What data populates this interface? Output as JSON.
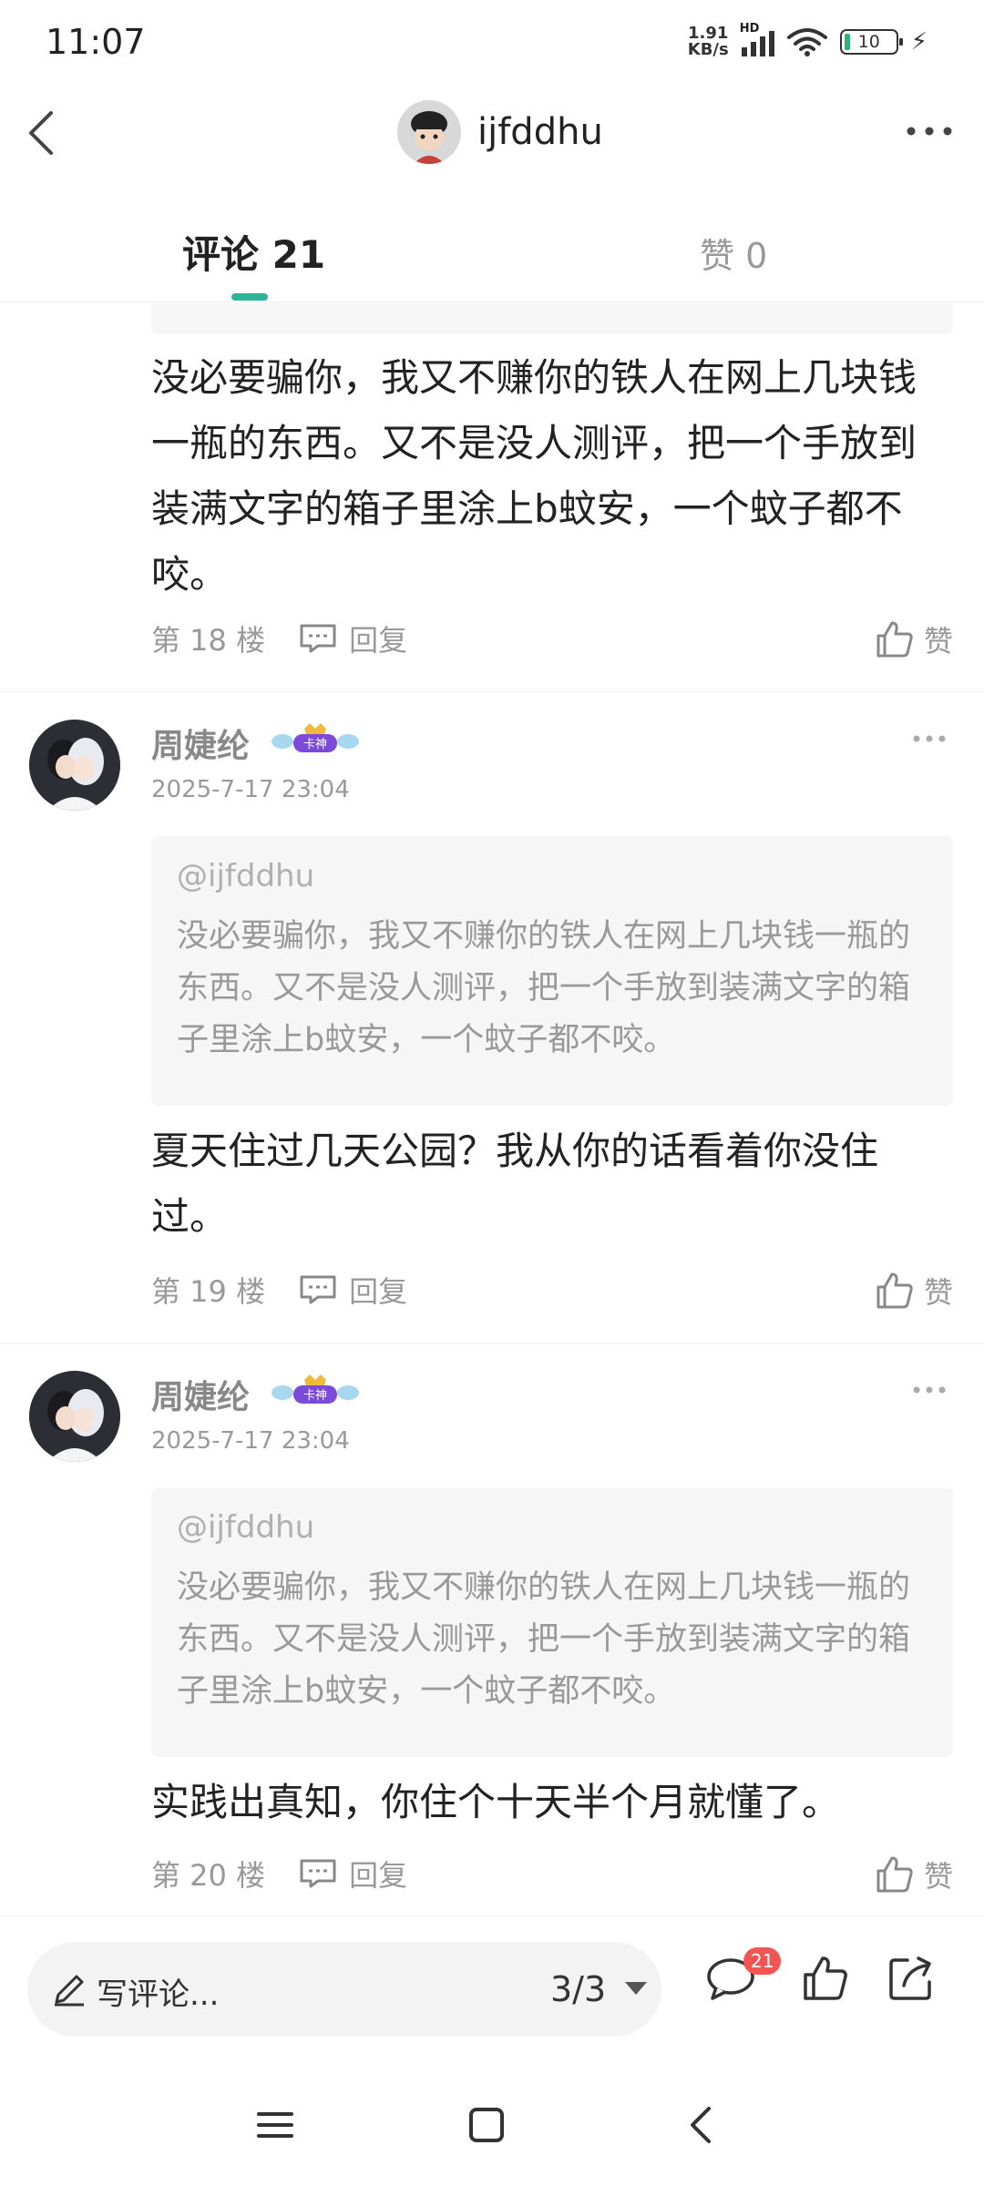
{
  "status_bar": {
    "time": "11:07",
    "net_speed_value": "1.91",
    "net_speed_unit": "KB/s",
    "network_label": "HD",
    "battery": "10"
  },
  "header": {
    "username": "ijfddhu",
    "back_icon": "chevron-left-icon",
    "more_icon": "more-horizontal-icon"
  },
  "tabs": {
    "comments_label": "评论 21",
    "likes_label": "赞 0"
  },
  "comments": [
    {
      "text": "没必要骗你，我又不赚你的铁人在网上几块钱一瓶的东西。又不是没人测评，把一个手放到装满文字的箱子里涂上b蚊安，一个蚊子都不咬。",
      "floor": "第 18 楼",
      "reply_label": "回复",
      "like_label": "赞"
    },
    {
      "name": "周婕纶",
      "badge": "卡神",
      "date": "2025-7-17 23:04",
      "quote_user": "@ijfddhu",
      "quote_text": "没必要骗你，我又不赚你的铁人在网上几块钱一瓶的东西。又不是没人测评，把一个手放到装满文字的箱子里涂上b蚊安，一个蚊子都不咬。",
      "text": "夏天住过几天公园？我从你的话看着你没住过。",
      "floor": "第 19 楼",
      "reply_label": "回复",
      "like_label": "赞"
    },
    {
      "name": "周婕纶",
      "badge": "卡神",
      "date": "2025-7-17 23:04",
      "quote_user": "@ijfddhu",
      "quote_text": "没必要骗你，我又不赚你的铁人在网上几块钱一瓶的东西。又不是没人测评，把一个手放到装满文字的箱子里涂上b蚊安，一个蚊子都不咬。",
      "text": "实践出真知，你住个十天半个月就懂了。",
      "floor": "第 20 楼",
      "reply_label": "回复",
      "like_label": "赞"
    }
  ],
  "bottom_bar": {
    "write_placeholder": "写评论...",
    "page_indicator": "3/3",
    "comment_count": "21"
  },
  "colors": {
    "accent": "#2bb69a",
    "badge_red": "#f35454",
    "muted_text": "#999999"
  }
}
